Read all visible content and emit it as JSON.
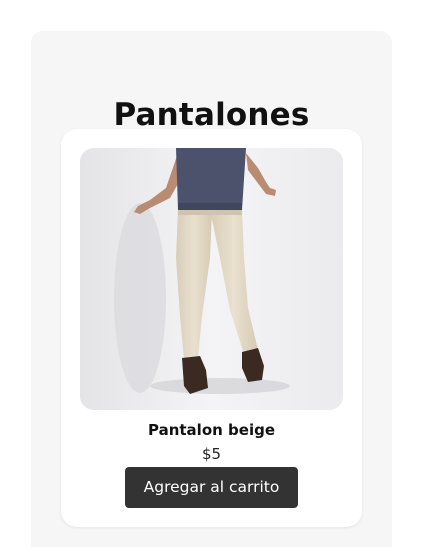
{
  "category": {
    "title": "Pantalones"
  },
  "product": {
    "name": "Pantalon beige",
    "price": "$5",
    "add_to_cart_label": "Agregar al carrito",
    "image_alt": "man-wearing-beige-pants-photo"
  },
  "colors": {
    "panel_background": "#f6f6f6",
    "card_background": "#ffffff",
    "button_background": "#333333",
    "button_text": "#ffffff",
    "shirt": "#4a5068",
    "pants": "#e3d9c6",
    "shoes": "#3a2a22"
  }
}
